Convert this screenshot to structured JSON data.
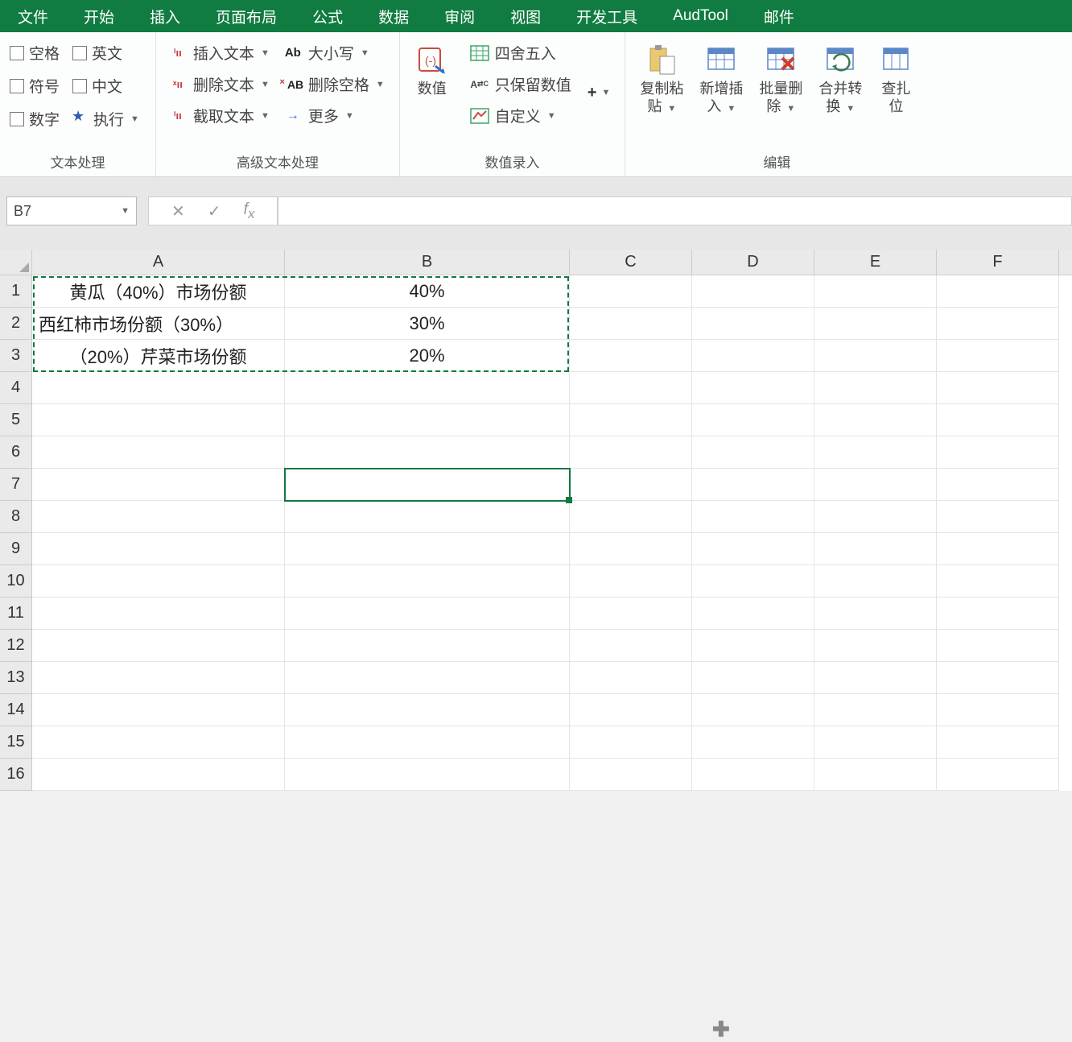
{
  "tabs": [
    "文件",
    "开始",
    "插入",
    "页面布局",
    "公式",
    "数据",
    "审阅",
    "视图",
    "开发工具",
    "AudTool",
    "邮件"
  ],
  "ribbon": {
    "group1": {
      "label": "文本处理",
      "checks_col1": [
        "空格",
        "符号",
        "数字"
      ],
      "checks_col2": [
        "英文",
        "中文",
        "执行"
      ]
    },
    "group2": {
      "label": "高级文本处理",
      "col1": [
        "插入文本",
        "删除文本",
        "截取文本"
      ],
      "col2": [
        "大小写",
        "删除空格",
        "更多"
      ],
      "col2_prefix": [
        "Ab",
        "",
        ""
      ]
    },
    "group3": {
      "label": "数值录入",
      "big_btn": "数值",
      "items": [
        "四舍五入",
        "只保留数值",
        "自定义"
      ]
    },
    "group4": {
      "label": "编辑",
      "btns": [
        {
          "l1": "复制粘",
          "l2": "贴"
        },
        {
          "l1": "新增插",
          "l2": "入"
        },
        {
          "l1": "批量删",
          "l2": "除"
        },
        {
          "l1": "合并转",
          "l2": "换"
        },
        {
          "l1": "查扎",
          "l2": "位"
        }
      ]
    }
  },
  "name_box": "B7",
  "columns": [
    "A",
    "B",
    "C",
    "D",
    "E",
    "F"
  ],
  "row_labels": [
    "1",
    "2",
    "3",
    "4",
    "5",
    "6",
    "7",
    "8",
    "9",
    "10",
    "11",
    "12",
    "13",
    "14",
    "15",
    "16"
  ],
  "data": {
    "r1": {
      "A": "黄瓜（40%）市场份额",
      "B": "40%"
    },
    "r2": {
      "A": "西红柿市场份额（30%）",
      "B": "30%"
    },
    "r3": {
      "A": "（20%）芹菜市场份额",
      "B": "20%"
    }
  },
  "selected_cell": "B7",
  "marching_range": "A1:B3"
}
